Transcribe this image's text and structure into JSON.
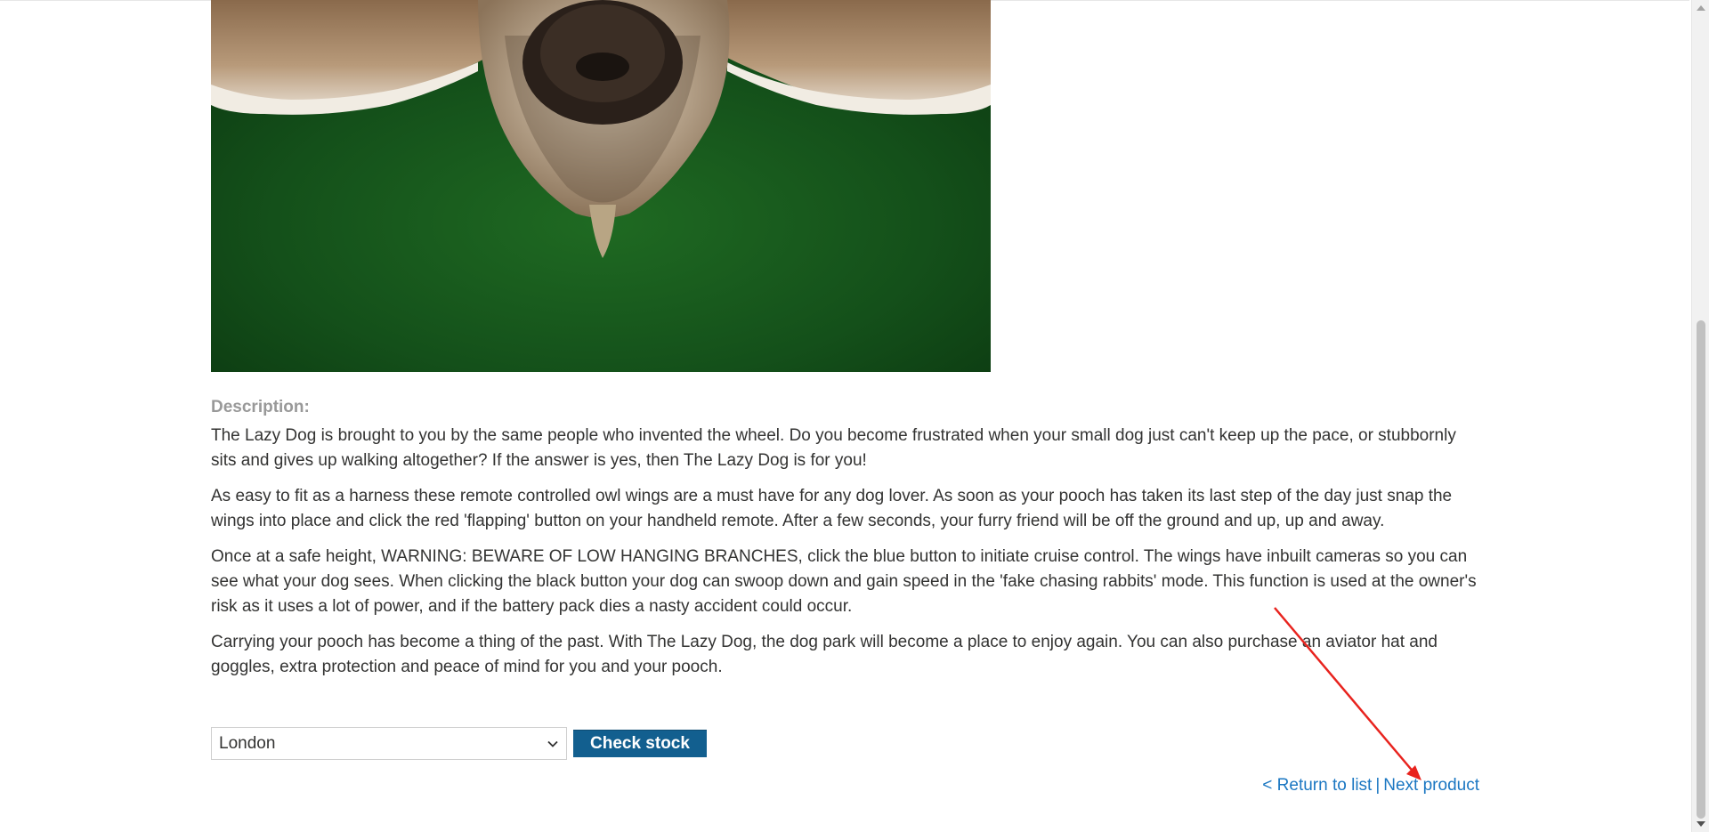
{
  "product": {
    "image_alt": "pug with owl wings"
  },
  "description": {
    "label": "Description:",
    "paragraphs": [
      "The Lazy Dog is brought to you by the same people who invented the wheel. Do you become frustrated when your small dog just can't keep up the pace, or stubbornly sits and gives up walking altogether? If the answer is yes, then The Lazy Dog is for you!",
      "As easy to fit as a harness these remote controlled owl wings are a must have for any dog lover. As soon as your pooch has taken its last step of the day just snap the wings into place and click the red 'flapping' button on your handheld remote. After a few seconds, your furry friend will be off the ground and up, up and away.",
      "Once at a safe height, WARNING: BEWARE OF LOW HANGING BRANCHES, click the blue button to initiate cruise control. The wings have inbuilt cameras so you can see what your dog sees. When clicking the black button your dog can swoop down and gain speed in the 'fake chasing rabbits' mode. This function is used at the owner's risk as it uses a lot of power, and if the battery pack dies a nasty accident could occur.",
      "Carrying your pooch has become a thing of the past. With The Lazy Dog, the dog park will become a place to enjoy again. You can also purchase an aviator hat and goggles, extra protection and peace of mind for you and your pooch."
    ]
  },
  "stock": {
    "selected_store": "London",
    "check_label": "Check stock"
  },
  "nav": {
    "return_label": "< Return to list",
    "separator": "|",
    "next_label": "Next product"
  },
  "colors": {
    "button_bg": "#125f8f",
    "link": "#1b77c2",
    "annotation": "#e8231e",
    "label_gray": "#999999"
  },
  "icons": {
    "select": "chevron-down-icon"
  }
}
